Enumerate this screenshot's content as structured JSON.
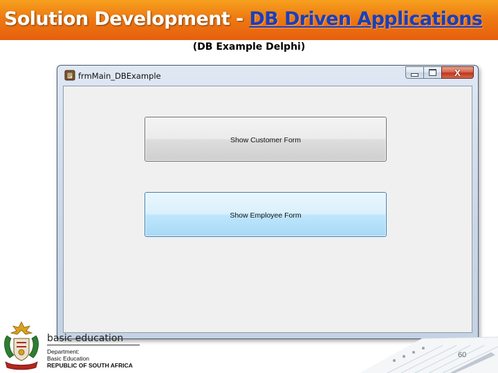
{
  "slide": {
    "title_plain": "Solution Development - ",
    "title_link": "DB Driven Applications",
    "subtitle": "(DB Example Delphi)",
    "page_number": "60"
  },
  "window": {
    "title": "frmMain_DBExample",
    "buttons": {
      "minimize_icon": "minimize-icon",
      "maximize_icon": "maximize-icon",
      "close_icon": "close-icon",
      "close_glyph": "X"
    },
    "form_buttons": [
      {
        "label": "Show Customer Form",
        "state": "normal"
      },
      {
        "label": "Show Employee Form",
        "state": "hot"
      }
    ]
  },
  "logo": {
    "top_text": "basic education",
    "line1": "Department:",
    "line2": "Basic Education",
    "line3": "REPUBLIC OF SOUTH AFRICA"
  },
  "colors": {
    "banner_orange": "#ee7a12",
    "title_link_blue": "#1b3fb8",
    "button_hot_blue": "#bee6fd"
  }
}
